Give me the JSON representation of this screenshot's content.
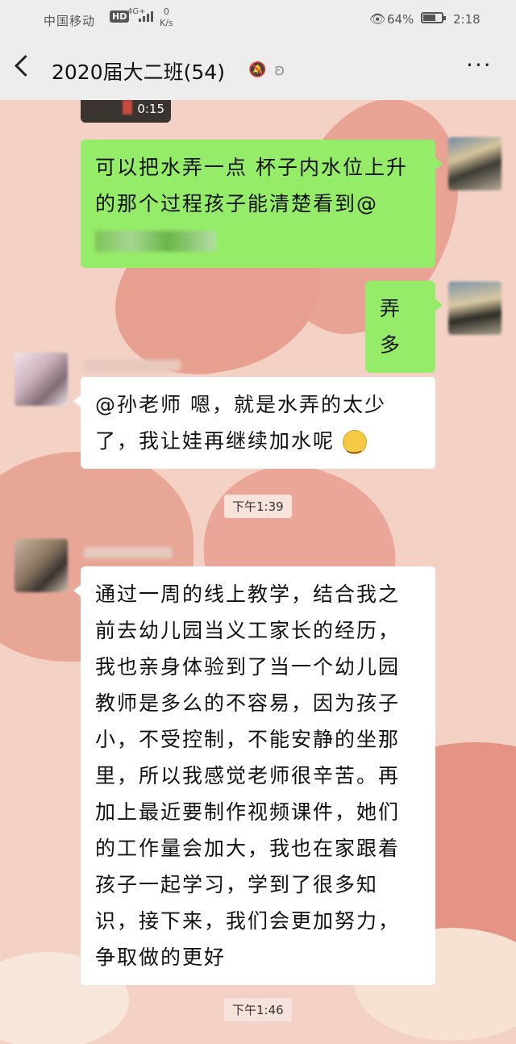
{
  "status_bar": {
    "carrier": "中国移动",
    "hd": "HD",
    "network": "4G+",
    "speed_value": "0",
    "speed_unit": "K/s",
    "battery": "64%",
    "time": "2:18"
  },
  "header": {
    "title": "2020届大二班(54)",
    "more": "···"
  },
  "messages": [
    {
      "side": "right",
      "type": "video",
      "duration": "0:15"
    },
    {
      "side": "right",
      "type": "text",
      "text": "可以把水弄一点 杯子内水位上升的那个过程孩子能清楚看到@"
    },
    {
      "side": "right",
      "type": "text",
      "text": "弄多"
    },
    {
      "side": "left",
      "type": "text",
      "text_before": "@孙老师 嗯，就是水弄的太少了，我让娃再继续加水呢",
      "emoji": "smile-emoji"
    },
    {
      "side": "left",
      "type": "text",
      "text": "通过一周的线上教学，结合我之前去幼儿园当义工家长的经历，我也亲身体验到了当一个幼儿园教师是多么的不容易，因为孩子小，不受控制，不能安静的坐那里，所以我感觉老师很辛苦。再加上最近要制作视频课件，她们的工作量会加大，我也在家跟着孩子一起学习，学到了很多知识，接下来，我们会更加努力，争取做的更好"
    }
  ],
  "timestamps": [
    "下午1:39",
    "下午1:46"
  ],
  "colors": {
    "sent_bubble": "#95ec69",
    "received_bubble": "#ffffff",
    "header_bg": "#ededed",
    "chat_bg": "#f3d2c5"
  }
}
